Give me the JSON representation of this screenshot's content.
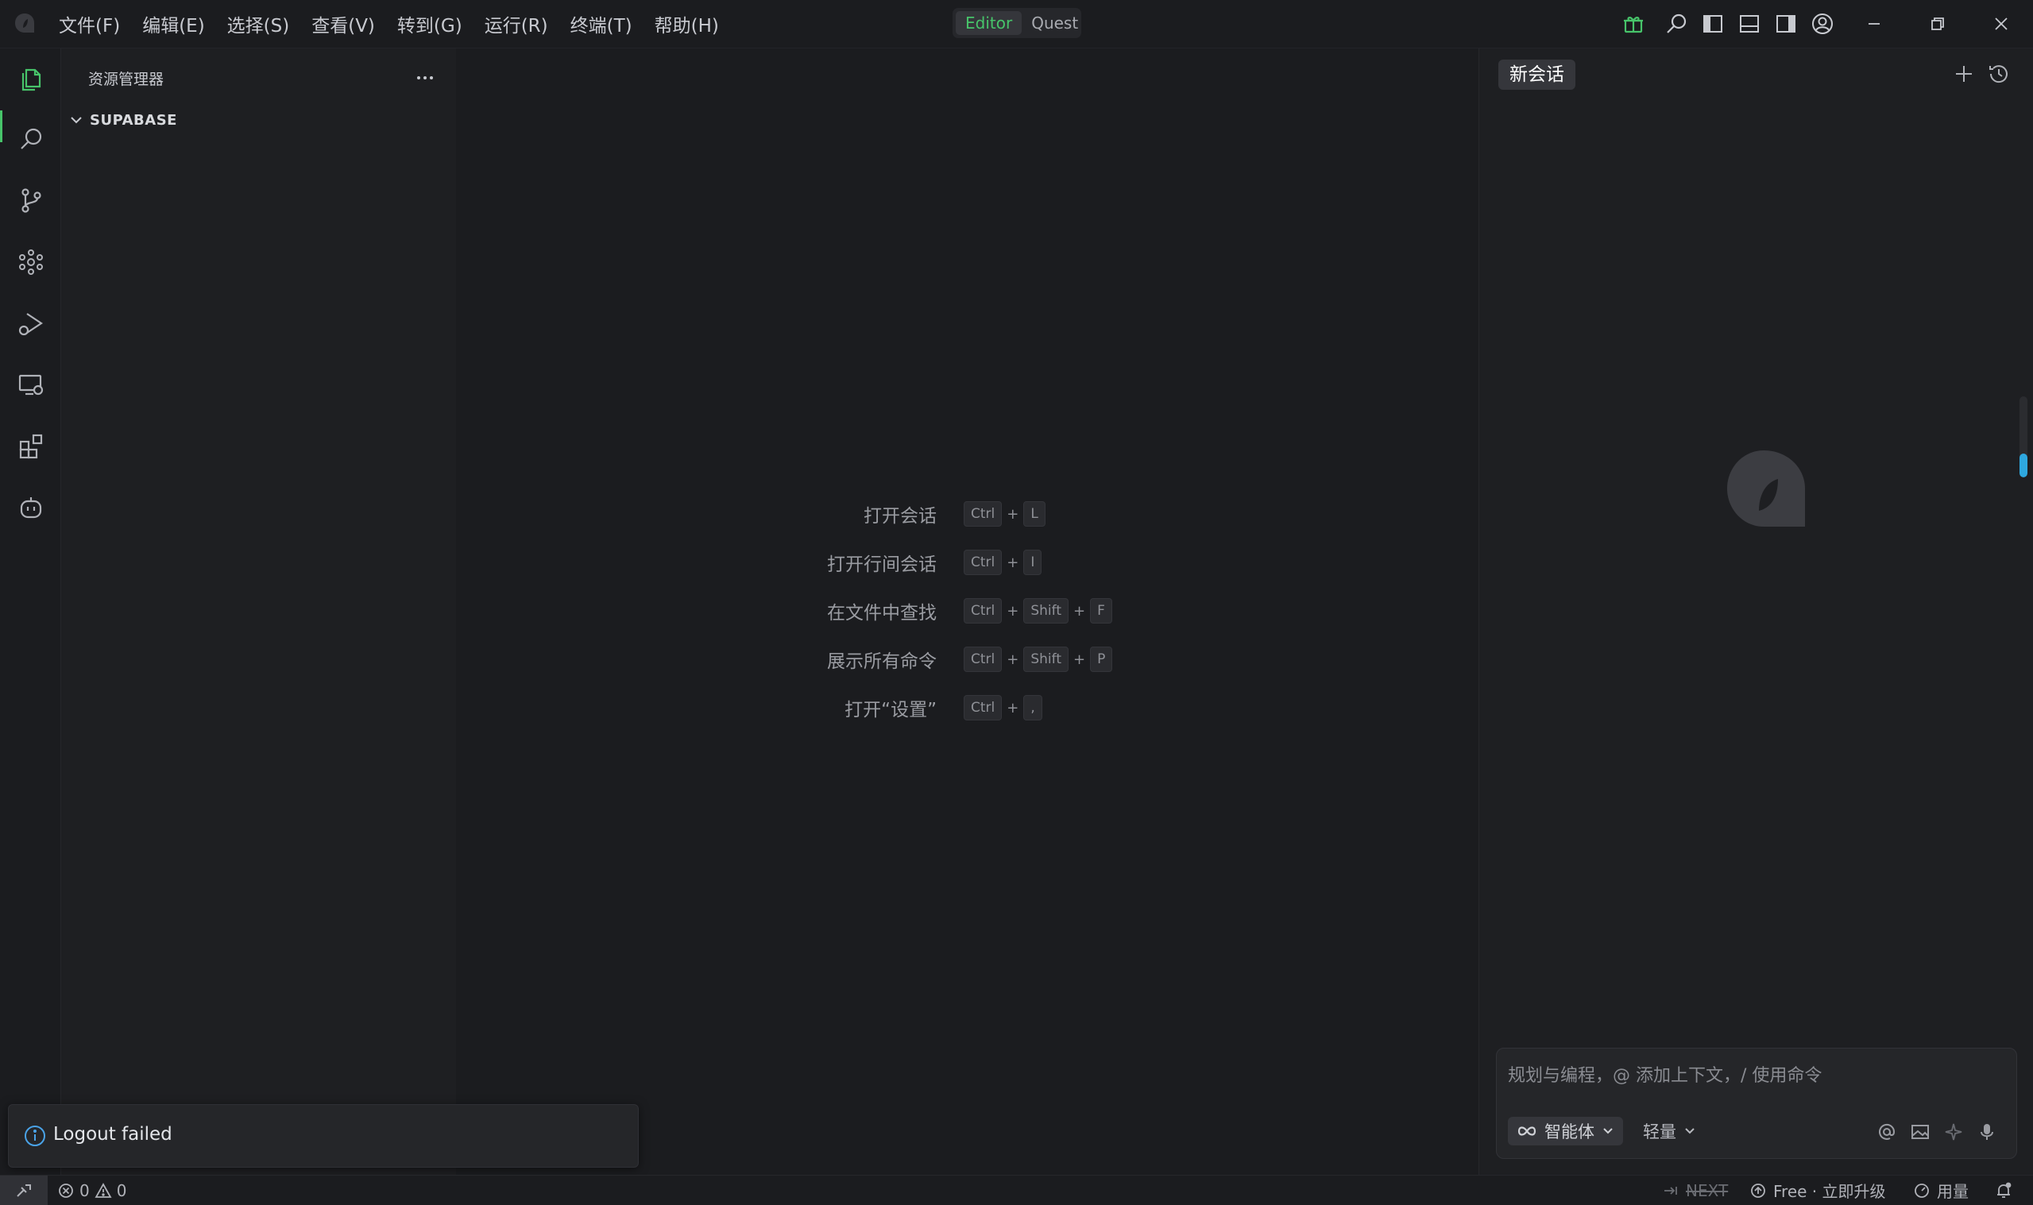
{
  "menu": {
    "items": [
      {
        "label": "文件(F)"
      },
      {
        "label": "编辑(E)"
      },
      {
        "label": "选择(S)"
      },
      {
        "label": "查看(V)"
      },
      {
        "label": "转到(G)"
      },
      {
        "label": "运行(R)"
      },
      {
        "label": "终端(T)"
      },
      {
        "label": "帮助(H)"
      }
    ]
  },
  "mode_toggle": {
    "active": "Editor",
    "inactive": "Quest"
  },
  "accent_color": "#47c46a",
  "explorer": {
    "title": "资源管理器",
    "folder": "SUPABASE"
  },
  "shortcuts": [
    {
      "label": "打开会话",
      "keys": [
        "Ctrl",
        "L"
      ]
    },
    {
      "label": "打开行间会话",
      "keys": [
        "Ctrl",
        "I"
      ]
    },
    {
      "label": "在文件中查找",
      "keys": [
        "Ctrl",
        "Shift",
        "F"
      ]
    },
    {
      "label": "展示所有命令",
      "keys": [
        "Ctrl",
        "Shift",
        "P"
      ]
    },
    {
      "label": "打开“设置”",
      "keys": [
        "Ctrl",
        ","
      ]
    }
  ],
  "chat": {
    "tab_label": "新会话",
    "input_placeholder": "规划与编程，@ 添加上下文，/ 使用命令",
    "agent_label": "智能体",
    "model_label": "轻量"
  },
  "toast": {
    "message": "Logout failed"
  },
  "status": {
    "errors": "0",
    "warnings": "0",
    "next_label": "NEXT",
    "plan_label": "Free · 立即升级",
    "usage_label": "用量"
  }
}
